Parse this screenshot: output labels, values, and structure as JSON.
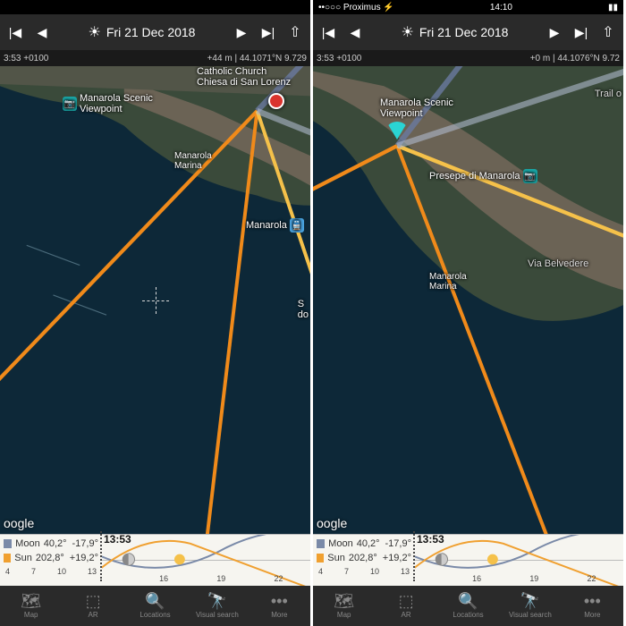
{
  "panes": [
    {
      "status": {
        "carrier": "",
        "time": "",
        "indicators": ""
      },
      "date_bar": {
        "date": "Fri 21 Dec 2018"
      },
      "info": {
        "left": "3:53 +0100",
        "right": "+44 m | 44.1071°N 9.729"
      },
      "pois": {
        "viewpoint": "Manarola Scenic\nViewpoint",
        "church": "Catholic Church\nChiesa di San Lorenz",
        "marina": "Manarola\nMarina",
        "station": "Manarola",
        "edge": "S\ndo"
      },
      "attribution": "oogle"
    },
    {
      "status": {
        "carrier": "••○○○ Proximus ⚡",
        "time": "14:10",
        "indicators": "▮▮"
      },
      "date_bar": {
        "date": "Fri 21 Dec 2018"
      },
      "info": {
        "left": "3:53 +0100",
        "right": "+0 m | 44.1076°N 9.72"
      },
      "pois": {
        "viewpoint": "Manarola Scenic\nViewpoint",
        "presepe": "Presepe di Manarola",
        "marina": "Manarola\nMarina",
        "belvedere": "Via Belvedere",
        "trail": "Trail o"
      },
      "attribution": "oogle"
    }
  ],
  "ephemeris": {
    "time_label": "13:53",
    "moon": {
      "label": "Moon",
      "az": "40,2°",
      "alt": "-17,9°",
      "color": "#7a8aa8"
    },
    "sun": {
      "label": "Sun",
      "az": "202,8°",
      "alt": "+19,2°",
      "color": "#f0a030"
    },
    "ticks_left": [
      "4",
      "7",
      "10",
      "13"
    ],
    "ticks_right": [
      "16",
      "19",
      "22"
    ]
  },
  "tabs": {
    "map": "Map",
    "ar": "AR",
    "locations": "Locations",
    "search": "Visual search",
    "more": "More"
  }
}
